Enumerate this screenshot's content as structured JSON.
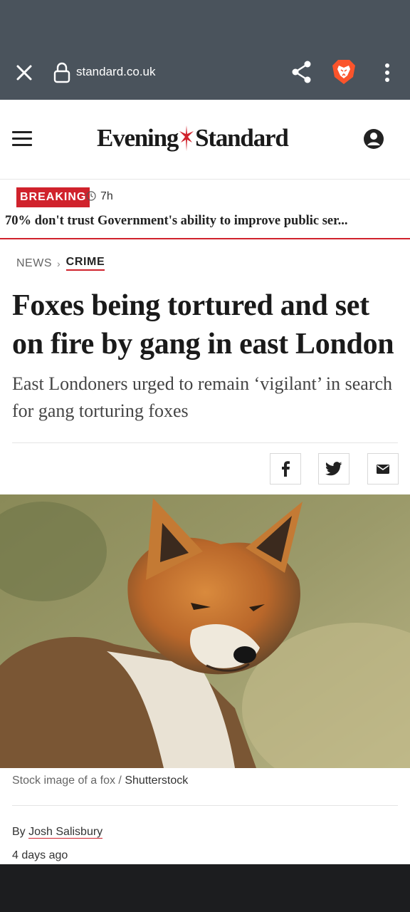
{
  "browser": {
    "url": "standard.co.uk",
    "close_icon": "close-icon",
    "lock_icon": "lock-icon",
    "share_icon": "share-icon",
    "brave_icon": "brave-lion-icon",
    "menu_icon": "more-vertical-icon"
  },
  "site": {
    "logo_left": "Evening",
    "logo_right": "Standard",
    "menu_icon": "hamburger-icon",
    "user_icon": "user-account-icon"
  },
  "breaking": {
    "badge": "BREAKING",
    "time": "7h",
    "headline": "70% don't trust Government's ability to improve public ser...",
    "accent": "#d0222c"
  },
  "breadcrumb": {
    "section": "NEWS",
    "subsection": "CRIME"
  },
  "article": {
    "headline": "Foxes being tortured and set on fire by gang in east London",
    "standfirst": "East Londoners urged to remain ‘vigilant’ in search for gang torturing foxes",
    "caption": "Stock image of a fox /",
    "caption_credit": "Shutterstock",
    "byline_prefix": "By",
    "author": "Josh Salisbury",
    "date": "4 days ago"
  },
  "share": {
    "facebook_icon": "facebook-icon",
    "twitter_icon": "twitter-icon",
    "email_icon": "email-icon"
  }
}
